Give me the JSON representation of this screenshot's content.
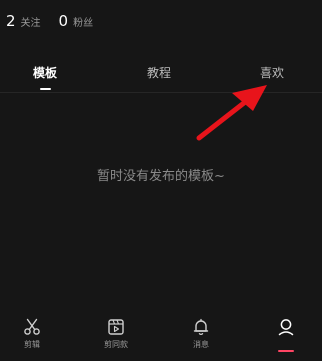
{
  "profile": {
    "following": {
      "count": "2",
      "label": "关注"
    },
    "followers": {
      "count": "0",
      "label": "粉丝"
    }
  },
  "tabs": [
    {
      "label": "模板",
      "active": true
    },
    {
      "label": "教程",
      "active": false
    },
    {
      "label": "喜欢",
      "active": false
    }
  ],
  "empty_state": {
    "text": "暂时没有发布的模板~"
  },
  "bottom_nav": [
    {
      "label": "剪辑",
      "icon": "scissors-icon"
    },
    {
      "label": "剪同款",
      "icon": "clapperboard-play-icon"
    },
    {
      "label": "消息",
      "icon": "bell-icon"
    },
    {
      "label": "",
      "icon": "person-icon",
      "active": true
    }
  ],
  "colors": {
    "background": "#161616",
    "text": "#ffffff",
    "muted": "#8a8a8a",
    "annotation_arrow": "#e8141b",
    "active_indicator": "#ff4563"
  }
}
